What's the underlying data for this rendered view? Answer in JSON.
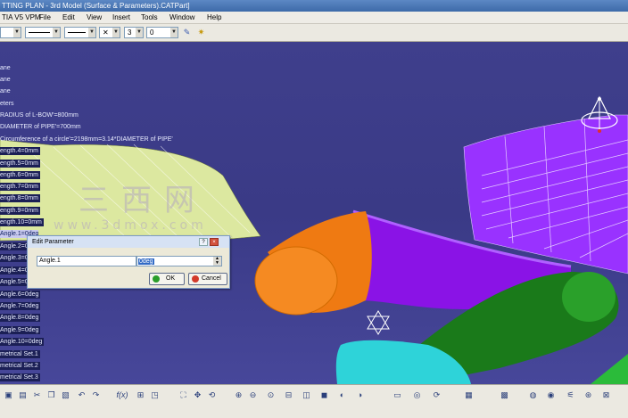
{
  "window": {
    "title": "TTING PLAN - 3rd Model (Surface & Parameters).CATPart]"
  },
  "menubar": {
    "app_tag": "TIA V5 VPM",
    "file": "File",
    "edit": "Edit",
    "view": "View",
    "insert": "Insert",
    "tools": "Tools",
    "window": "Window",
    "help": "Help"
  },
  "propbar": {
    "layer_value": "3",
    "weight_value": "0"
  },
  "tree": {
    "nodes": [
      "ane",
      "ane",
      "ane",
      "eters",
      "RADIUS of L-BOW'=800mm",
      "DIAMETER of PIPE'=700mm",
      "Circumference of a circle'=2198mm=3.14*DIAMETER of PIPE'",
      "ength.4=0mm",
      "ength.5=0mm",
      "ength.6=0mm",
      "ength.7=0mm",
      "ength.8=0mm",
      "ength.9=0mm",
      "ength.10=0mm",
      "Angle.1=0deg",
      "Angle.2=0deg",
      "Angle.3=0deg",
      "Angle.4=0deg",
      "Angle.5=0deg",
      "Angle.6=0deg",
      "Angle.7=0deg",
      "Angle.8=0deg",
      "Angle.9=0deg",
      "Angle.10=0deg",
      "metrical Set.1",
      "metrical Set.2",
      "metrical Set.3"
    ]
  },
  "dialog": {
    "title": "Edit Parameter",
    "param_name": "Angle.1",
    "param_value": "0deg",
    "ok_label": "OK",
    "cancel_label": "Cancel"
  },
  "watermark": {
    "chars": "三西网",
    "url": "www.3dmox.com"
  },
  "colors": {
    "background": "#3a3a86",
    "orange": "#ef7a12",
    "purple": "#8a13e6",
    "green": "#1a7a1a",
    "cyan": "#2ed3d9",
    "surface_purple": "#9932ff",
    "surface_yellow": "#dce8a0"
  },
  "toolbar_icons": [
    "save-icon",
    "print-icon",
    "cut-icon",
    "copy-icon",
    "paste-icon",
    "undo-icon",
    "redo-icon",
    "formula-icon",
    "measure-icon",
    "fly-icon",
    "fit-all-icon",
    "pan-icon",
    "rotate-icon",
    "zoom-in-icon",
    "zoom-out-icon",
    "normal-view-icon",
    "multi-view-icon",
    "iso-view-icon",
    "shading-icon",
    "hide-show-icon",
    "swap-icon",
    "capture-icon",
    "analysis-icon",
    "update-icon"
  ]
}
